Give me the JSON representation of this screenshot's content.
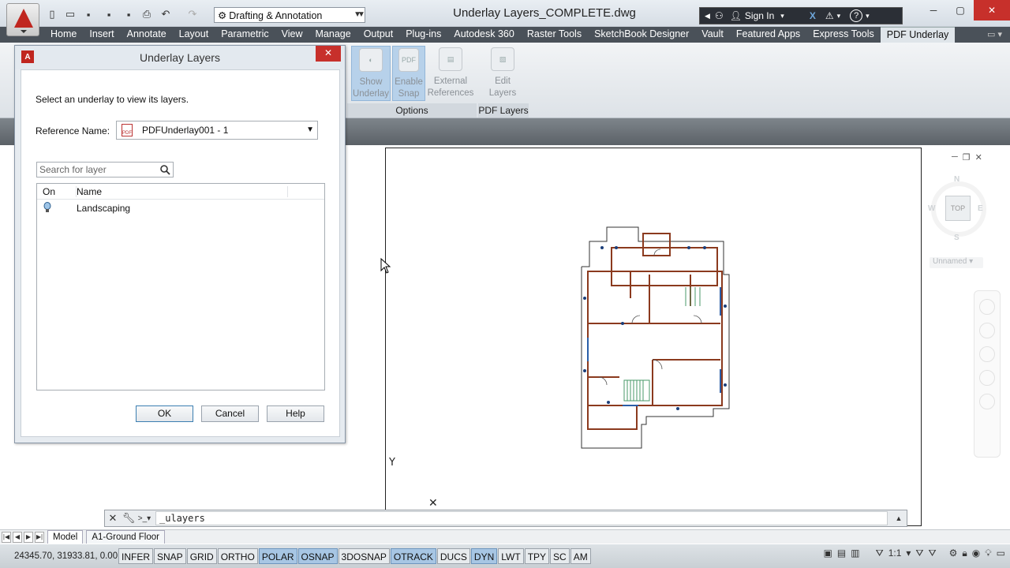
{
  "window": {
    "title": "Underlay Layers_COMPLETE.dwg",
    "workspace": "Drafting & Annotation",
    "sign_in": "Sign In"
  },
  "ribbon": {
    "tabs": [
      "Home",
      "Insert",
      "Annotate",
      "Layout",
      "Parametric",
      "View",
      "Manage",
      "Output",
      "Plug-ins",
      "Autodesk 360",
      "Raster Tools",
      "SketchBook Designer",
      "Vault",
      "Featured Apps",
      "Express Tools",
      "PDF Underlay"
    ],
    "active_tab": "PDF Underlay",
    "buttons": {
      "show_underlay": [
        "Show",
        "Underlay"
      ],
      "enable_snap": [
        "Enable",
        "Snap"
      ],
      "external_references": [
        "External",
        "References"
      ],
      "edit_layers": [
        "Edit",
        "Layers"
      ]
    },
    "panels": {
      "options": "Options",
      "pdf_layers": "PDF Layers"
    }
  },
  "dialog": {
    "title": "Underlay Layers",
    "instruction": "Select an underlay to view its layers.",
    "reference_name_label": "Reference Name:",
    "reference_name_value": "PDFUnderlay001 - 1",
    "search_placeholder": "Search for layer",
    "columns": {
      "on": "On",
      "name": "Name"
    },
    "layers": [
      {
        "name": "Landscaping",
        "on": true
      }
    ],
    "buttons": {
      "ok": "OK",
      "cancel": "Cancel",
      "help": "Help"
    }
  },
  "viewcube": {
    "face": "TOP",
    "north": "N",
    "south": "S",
    "east": "E",
    "west": "W",
    "ucs": "Unnamed"
  },
  "command_line": {
    "value": "_ulayers"
  },
  "layout_tabs": [
    "Model",
    "A1-Ground Floor"
  ],
  "status": {
    "coordinates": "24345.70, 31933.81, 0.00",
    "toggles": [
      {
        "label": "INFER",
        "on": false
      },
      {
        "label": "SNAP",
        "on": false
      },
      {
        "label": "GRID",
        "on": false
      },
      {
        "label": "ORTHO",
        "on": false
      },
      {
        "label": "POLAR",
        "on": true
      },
      {
        "label": "OSNAP",
        "on": true
      },
      {
        "label": "3DOSNAP",
        "on": false
      },
      {
        "label": "OTRACK",
        "on": true
      },
      {
        "label": "DUCS",
        "on": false
      },
      {
        "label": "DYN",
        "on": true
      },
      {
        "label": "LWT",
        "on": false
      },
      {
        "label": "TPY",
        "on": false
      },
      {
        "label": "SC",
        "on": false
      },
      {
        "label": "AM",
        "on": false
      }
    ],
    "annotation_scale": "1:1"
  },
  "colors": {
    "accent_red": "#c0261f",
    "toggle_on": "#a7c6e4",
    "wall_brown": "#8b3a1e"
  }
}
